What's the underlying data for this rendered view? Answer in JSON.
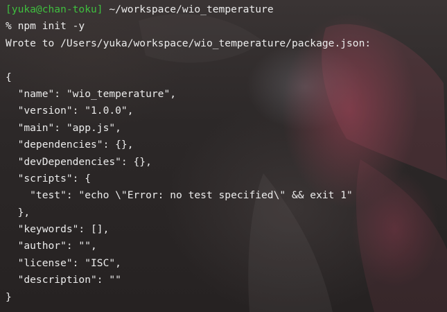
{
  "terminal": {
    "prompt": {
      "user_host": "[yuka@chan-toku]",
      "cwd": " ~/workspace/wio_temperature"
    },
    "lines": [
      "% npm init -y",
      "Wrote to /Users/yuka/workspace/wio_temperature/package.json:",
      "",
      "{",
      "  \"name\": \"wio_temperature\",",
      "  \"version\": \"1.0.0\",",
      "  \"main\": \"app.js\",",
      "  \"dependencies\": {},",
      "  \"devDependencies\": {},",
      "  \"scripts\": {",
      "    \"test\": \"echo \\\"Error: no test specified\\\" && exit 1\"",
      "  },",
      "  \"keywords\": [],",
      "  \"author\": \"\",",
      "  \"license\": \"ISC\",",
      "  \"description\": \"\"",
      "}"
    ]
  },
  "colors": {
    "prompt_user": "#3fbf3f",
    "text": "#ececec",
    "background": "#2c2828"
  }
}
